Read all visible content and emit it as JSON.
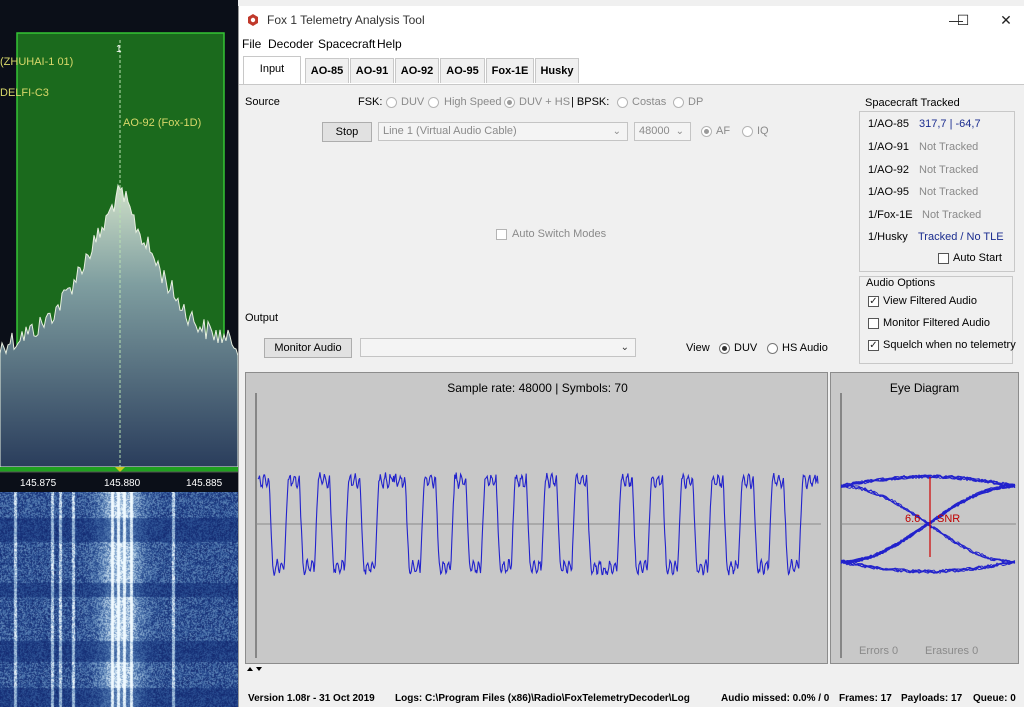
{
  "sdr": {
    "labels": [
      "(ZHUHAI-1 01)",
      "DELFI-C3",
      "AO-92 (Fox-1D)"
    ],
    "channel_number": "1",
    "freq_ticks": [
      "145.875",
      "145.880",
      "145.885"
    ]
  },
  "window": {
    "title": "Fox 1 Telemetry Analysis Tool",
    "controls": {
      "minimize": "—",
      "maximize": "☐",
      "close": "✕"
    }
  },
  "menu": [
    "File",
    "Decoder",
    "Spacecraft",
    "Help"
  ],
  "tabs": [
    "Input",
    "AO-85",
    "AO-91",
    "AO-92",
    "AO-95",
    "Fox-1E",
    "Husky"
  ],
  "source": {
    "label": "Source",
    "fsk_label": "FSK:",
    "fsk_options": [
      "DUV",
      "High Speed",
      "DUV + HS"
    ],
    "fsk_selected": "DUV + HS",
    "bpsk_label": "| BPSK:",
    "bpsk_options": [
      "Costas",
      "DP"
    ],
    "stop_button": "Stop",
    "device": "Line 1 (Virtual Audio Cable)",
    "rate": "48000",
    "af_label": "AF",
    "iq_label": "IQ",
    "auto_switch": "Auto Switch Modes"
  },
  "spacecraft_tracked": {
    "title": "Spacecraft Tracked",
    "rows": [
      {
        "name": "1/AO-85",
        "status": "317,7 | -64,7",
        "kind": "active"
      },
      {
        "name": "1/AO-91",
        "status": "Not Tracked",
        "kind": "off"
      },
      {
        "name": "1/AO-92",
        "status": "Not Tracked",
        "kind": "off"
      },
      {
        "name": "1/AO-95",
        "status": "Not Tracked",
        "kind": "off"
      },
      {
        "name": "1/Fox-1E",
        "status": "Not Tracked",
        "kind": "off"
      },
      {
        "name": "1/Husky",
        "status": "Tracked / No TLE",
        "kind": "active"
      }
    ],
    "auto_start": "Auto Start"
  },
  "audio_options": {
    "title": "Audio Options",
    "items": [
      {
        "label": "View Filtered Audio",
        "checked": true
      },
      {
        "label": "Monitor Filtered Audio",
        "checked": false
      },
      {
        "label": "Squelch when no telemetry",
        "checked": true
      }
    ]
  },
  "output": {
    "label": "Output",
    "monitor_button": "Monitor Audio",
    "view_label": "View",
    "view_options": [
      "DUV",
      "HS Audio"
    ],
    "view_selected": "DUV"
  },
  "waveform": {
    "caption": "Sample rate: 48000 | Symbols: 70",
    "trace_color": "#2222cc"
  },
  "eye": {
    "title": "Eye Diagram",
    "snr_value": "6.6",
    "snr_label": "SNR",
    "errors": "Errors  0",
    "erasures": "Erasures  0"
  },
  "status": {
    "version": "Version 1.08r - 31 Oct 2019",
    "logs": "Logs: C:\\Program Files (x86)\\Radio\\FoxTelemetryDecoder\\Log",
    "audio_missed": "Audio missed: 0.0% / 0",
    "frames": "Frames: 17",
    "payloads": "Payloads: 17",
    "queue": "Queue: 0"
  }
}
